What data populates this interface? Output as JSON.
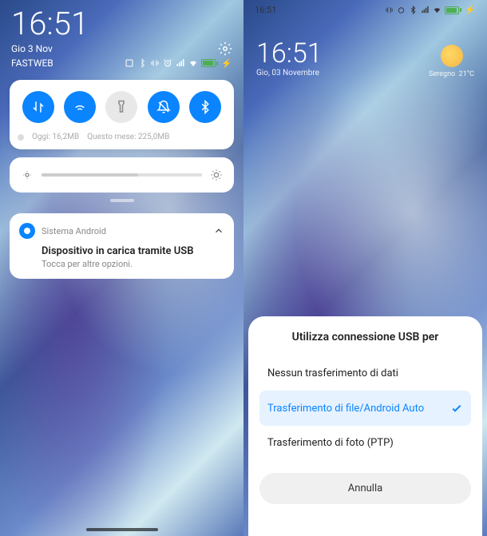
{
  "left": {
    "time": "16:51",
    "date": "Gio 3 Nov",
    "carrier": "FASTWEB",
    "quick_settings": {
      "toggles": [
        {
          "name": "data-toggle",
          "icon": "data",
          "on": true
        },
        {
          "name": "wifi-toggle",
          "icon": "wifi",
          "on": true
        },
        {
          "name": "flashlight-toggle",
          "icon": "flashlight",
          "on": false
        },
        {
          "name": "dnd-toggle",
          "icon": "bell-off",
          "on": true
        },
        {
          "name": "bluetooth-toggle",
          "icon": "bluetooth",
          "on": true
        }
      ],
      "data_today_label": "Oggi: 16,2MB",
      "data_month_label": "Questo mese: 225,0MB"
    },
    "notification": {
      "app": "Sistema Android",
      "title": "Dispositivo in carica tramite USB",
      "body": "Tocca per altre opzioni."
    }
  },
  "right": {
    "status_time": "16:51",
    "home_time": "16:51",
    "home_date": "Gio, 03 Novembre",
    "weather": {
      "location": "Seregno",
      "temp": "21°C"
    },
    "usb_dialog": {
      "title": "Utilizza connessione USB per",
      "options": [
        {
          "label": "Nessun trasferimento di dati",
          "selected": false
        },
        {
          "label": "Trasferimento di file/Android Auto",
          "selected": true
        },
        {
          "label": "Trasferimento di foto (PTP)",
          "selected": false
        }
      ],
      "cancel": "Annulla"
    }
  }
}
